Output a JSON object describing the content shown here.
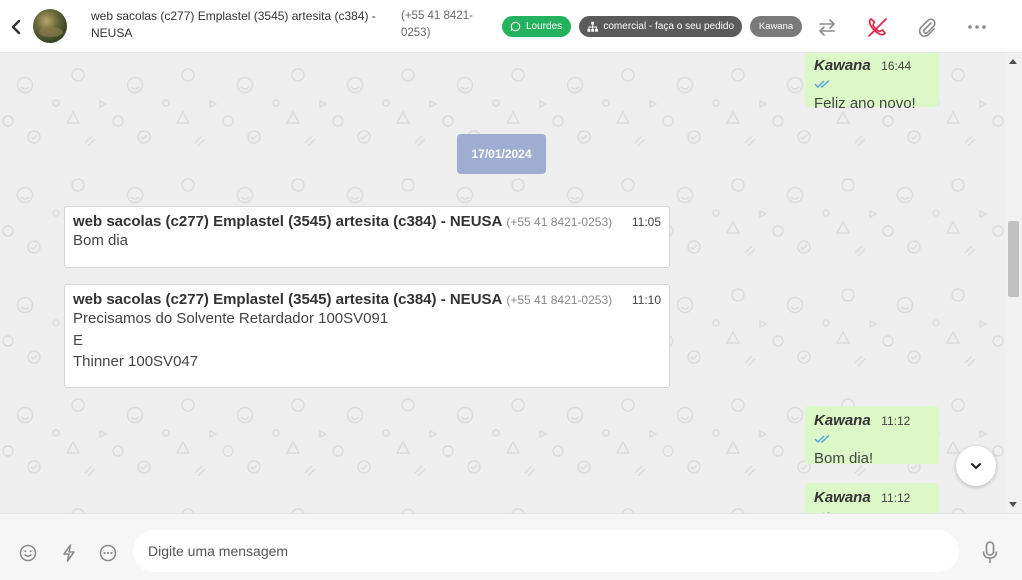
{
  "header": {
    "contact_name": "web sacolas (c277) Emplastel (3545) artesita (c384) - NEUSA",
    "contact_phone": "(+55 41 8421-0253)",
    "tag_agent": "Lourdes",
    "tag_department": "comercial - faça o seu pedido",
    "tag_user": "Kawana",
    "colors": {
      "whatsapp_green": "#25b25e",
      "dept_gray": "#5b5b5b",
      "user_gray": "#7a7a7a",
      "call_red": "#e0244a"
    },
    "icons": [
      "back-icon",
      "whatsapp-icon",
      "sitemap-icon",
      "transfer-icon",
      "end-call-icon",
      "attach-icon",
      "more-icon"
    ]
  },
  "messages": {
    "m1": {
      "sender": "Kawana",
      "time": "16:44",
      "text": "Feliz ano novo!"
    },
    "date_separator": "17/01/2024",
    "m2": {
      "sender": "web sacolas (c277) Emplastel (3545) artesita (c384) - NEUSA",
      "phone": "(+55 41 8421-0253)",
      "time": "11:05",
      "text": "Bom dia"
    },
    "m3": {
      "sender": "web sacolas (c277) Emplastel (3545) artesita (c384) - NEUSA",
      "phone": "(+55 41 8421-0253)",
      "time": "11:10",
      "lines": [
        "Precisamos do Solvente Retardador 100SV091",
        "E",
        "Thinner 100SV047"
      ]
    },
    "m4": {
      "sender": "Kawana",
      "time": "11:12",
      "text": "Bom dia!"
    },
    "m5": {
      "sender": "Kawana",
      "time": "11:12"
    }
  },
  "composer": {
    "placeholder": "Digite uma mensagem",
    "icons": [
      "emoji-icon",
      "lightning-icon",
      "quick-reply-icon",
      "microphone-icon"
    ]
  }
}
